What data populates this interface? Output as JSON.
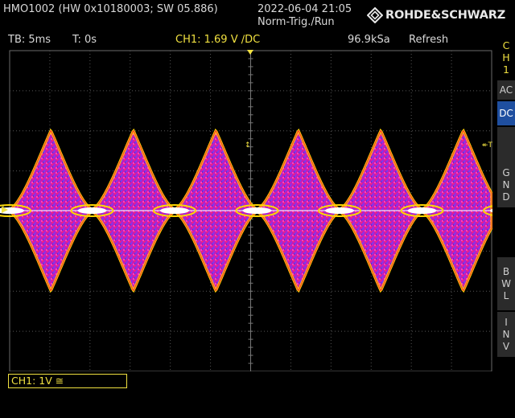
{
  "header": {
    "firmware_info": "HMO1002 (HW 0x10180003; SW 05.886)",
    "datetime": "2022-06-04 21:05",
    "trigger_state": "Norm-Trig./Run",
    "brand": "ROHDE&SCHWARZ"
  },
  "status": {
    "timebase": "TB: 5ms",
    "time_offset": "T: 0s",
    "trigger": "CH1: 1.69 V ∕DC",
    "sample_rate": "96.9kSa",
    "mode": "Refresh"
  },
  "sidebar": {
    "channel": [
      "C",
      "H",
      "1"
    ],
    "ac": "AC",
    "dc": "DC",
    "gnd": [
      "G",
      "N",
      "D"
    ],
    "bwl": [
      "B",
      "W",
      "L"
    ],
    "inv": [
      "I",
      "N",
      "V"
    ]
  },
  "markers": {
    "ground_marker": "1",
    "trigger_marker": "T"
  },
  "channel_box": {
    "label": "CH1: 1V ≅"
  },
  "colors": {
    "trace_hot": "#ffffff",
    "trace_mid": "#ffd800",
    "trace_warm": "#ff3a30",
    "trace_body": "#e020c0",
    "trace_cool": "#8040ff",
    "channel_yellow": "#f0e040",
    "active_key": "#1f4fa0"
  }
}
